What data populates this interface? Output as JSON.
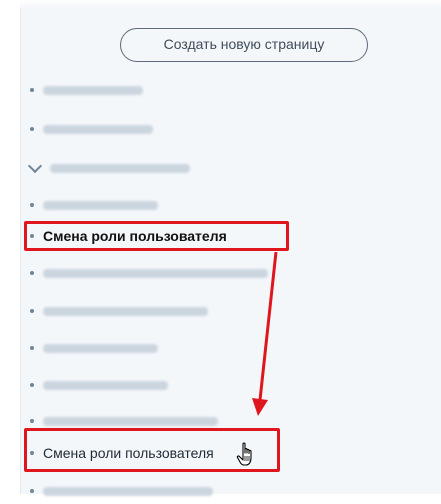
{
  "actions": {
    "create_page_label": "Создать новую страницу"
  },
  "nav": {
    "active_item_label": "Смена роли пользователя",
    "moved_item_label": "Смена роли пользователя"
  },
  "annotation": {
    "highlight_color": "#e0161e",
    "arrow_color": "#e0161e"
  }
}
